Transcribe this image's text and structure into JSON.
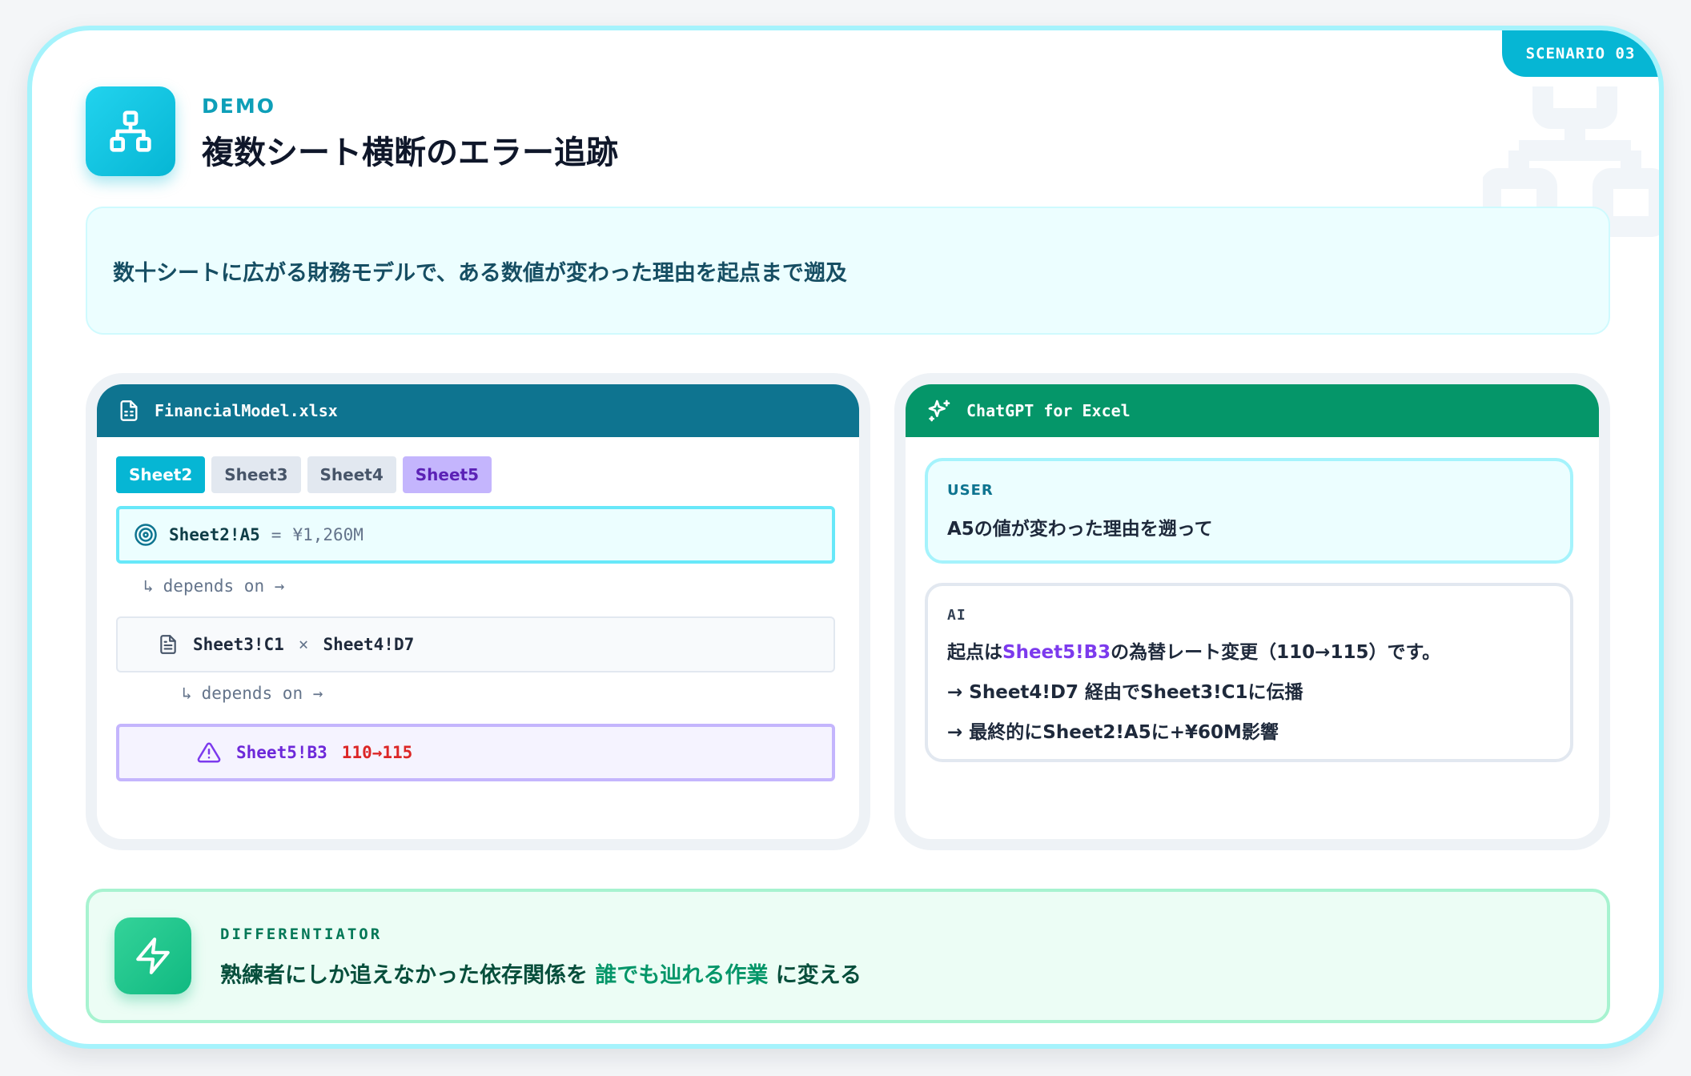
{
  "scenario_badge": "SCENARIO 03",
  "header": {
    "tag": "DEMO",
    "title": "複数シート横断のエラー追跡",
    "icon": "sitemap-icon"
  },
  "description": "数十シートに広がる財務モデルで、ある数値が変わった理由を起点まで遡及",
  "spreadsheet": {
    "file_name": "FinancialModel.xlsx",
    "tabs": [
      {
        "label": "Sheet2",
        "state": "active"
      },
      {
        "label": "Sheet3",
        "state": "normal"
      },
      {
        "label": "Sheet4",
        "state": "normal"
      },
      {
        "label": "Sheet5",
        "state": "highlighted"
      }
    ],
    "trace": {
      "root": {
        "cell": "Sheet2!A5",
        "equals": "=",
        "value": "¥1,260M"
      },
      "depends_label": "depends on →",
      "middle": {
        "left": "Sheet3!C1",
        "op": "×",
        "right": "Sheet4!D7"
      },
      "origin": {
        "cell": "Sheet5!B3",
        "change": "110→115"
      }
    }
  },
  "chat": {
    "title": "ChatGPT for Excel",
    "user_role": "USER",
    "user_message": "A5の値が変わった理由を遡って",
    "ai_role": "AI",
    "ai_line1_prefix": "起点は",
    "ai_line1_ref": "Sheet5!B3",
    "ai_line1_suffix": "の為替レート変更（110→115）です。",
    "ai_line2": "→ Sheet4!D7 経由でSheet3!C1に伝播",
    "ai_line3": "→ 最終的にSheet2!A5に+¥60M影響"
  },
  "differentiator": {
    "tag": "DIFFERENTIATOR",
    "text_before": "熟練者にしか追えなかった依存関係を ",
    "text_emphasis": "誰でも辿れる作業",
    "text_after": " に変える"
  },
  "colors": {
    "accent": "#06b6d4",
    "sheet_header": "#0e7490",
    "chat_header": "#059669",
    "highlight": "#7c3aed",
    "error": "#dc2626"
  }
}
